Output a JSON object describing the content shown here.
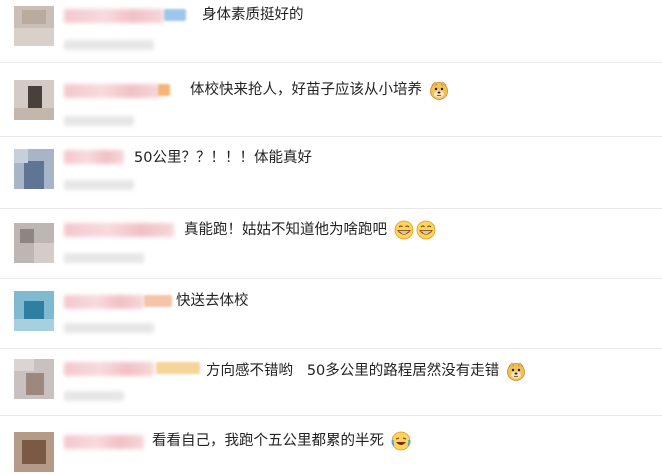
{
  "comments": [
    {
      "text": "身体素质挺好的"
    },
    {
      "text": "体校快来抢人，好苗子应该从小培养"
    },
    {
      "text": "50公里？？！！！体能真好"
    },
    {
      "text": "真能跑！姑姑不知道他为啥跑吧"
    },
    {
      "text": "快送去体校"
    },
    {
      "text": "方向感不错哟   50多公里的路程居然没有走错"
    },
    {
      "text": "看看自己，我跑个五公里都累的半死"
    }
  ],
  "emojis": {
    "row2": "doge-emoji",
    "row4": "grin-emoji",
    "row6": "doge-emoji",
    "row7": "laugh-cry-emoji"
  },
  "colors": {
    "separator": "#e9e9e9",
    "text": "#222222",
    "name_blur": "#f3c7cc"
  }
}
